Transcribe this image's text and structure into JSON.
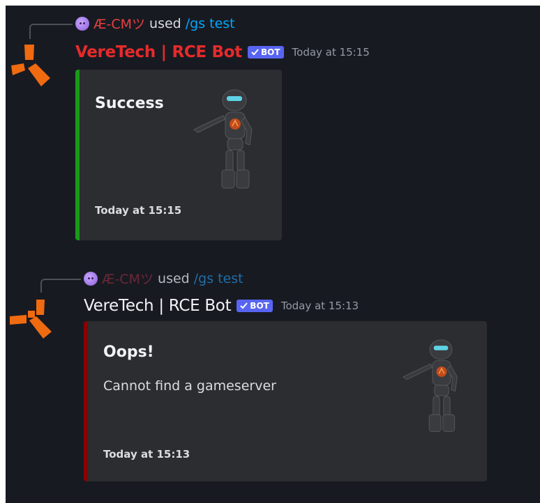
{
  "messages": [
    {
      "reply": {
        "username": "Æ-CMツ",
        "used_text": "used",
        "command": "/gs test"
      },
      "author": "VereTech | RCE Bot",
      "bot_badge": "BOT",
      "timestamp": "Today at 15:15",
      "embed": {
        "title": "Success",
        "description": "",
        "footer": "Today at 15:15",
        "color": "#1a9a1a",
        "thumbnail": "robot-thumbnail"
      }
    },
    {
      "reply": {
        "username": "Æ-CMツ",
        "used_text": "used",
        "command": "/gs test"
      },
      "author": "VereTech | RCE Bot",
      "bot_badge": "BOT",
      "timestamp": "Today at 15:13",
      "embed": {
        "title": "Oops!",
        "description": "Cannot find a gameserver",
        "footer": "Today at 15:13",
        "color": "#8b0000",
        "thumbnail": "robot-thumbnail"
      }
    }
  ],
  "icons": {
    "avatar": "orange-bracket-logo-icon",
    "reply_avatar": "purple-face-avatar-icon",
    "verified": "checkmark-icon"
  },
  "colors": {
    "background": "#181a22",
    "embed_bg": "#2b2d31",
    "bot_badge": "#5865f2",
    "link": "#00a8fc",
    "author_highlight": "#e62b2b"
  }
}
